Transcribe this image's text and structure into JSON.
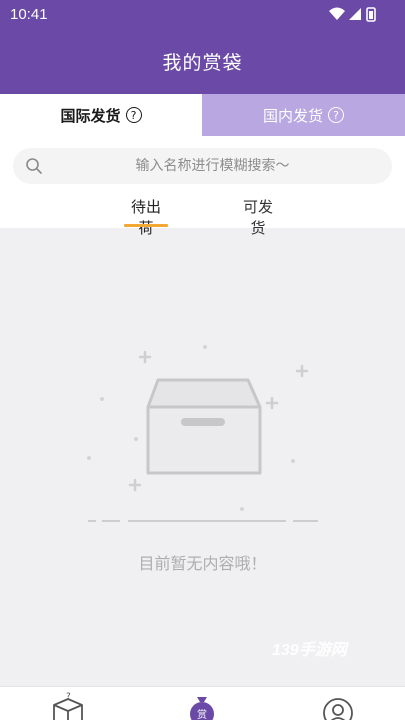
{
  "status_bar": {
    "time": "10:41"
  },
  "header": {
    "title": "我的赏袋"
  },
  "shipping_tabs": [
    {
      "label": "国际发货",
      "active": true
    },
    {
      "label": "国内发货",
      "active": false
    }
  ],
  "search": {
    "placeholder": "输入名称进行模糊搜索～"
  },
  "status_tabs": [
    {
      "label": "待出荷",
      "active": true
    },
    {
      "label": "可发货",
      "active": false
    }
  ],
  "empty_state": {
    "message": "目前暂无内容哦！"
  },
  "watermark": "139手游网",
  "bottom_nav": {
    "items": [
      {
        "icon": "mystery-box-icon"
      },
      {
        "icon": "reward-bag-icon",
        "badge": "赏"
      },
      {
        "icon": "profile-icon"
      }
    ]
  },
  "colors": {
    "primary": "#6a4aa6",
    "tab_inactive": "#b9a7e2",
    "accent_underline": "#f2a833",
    "background": "#f0f0f2"
  }
}
